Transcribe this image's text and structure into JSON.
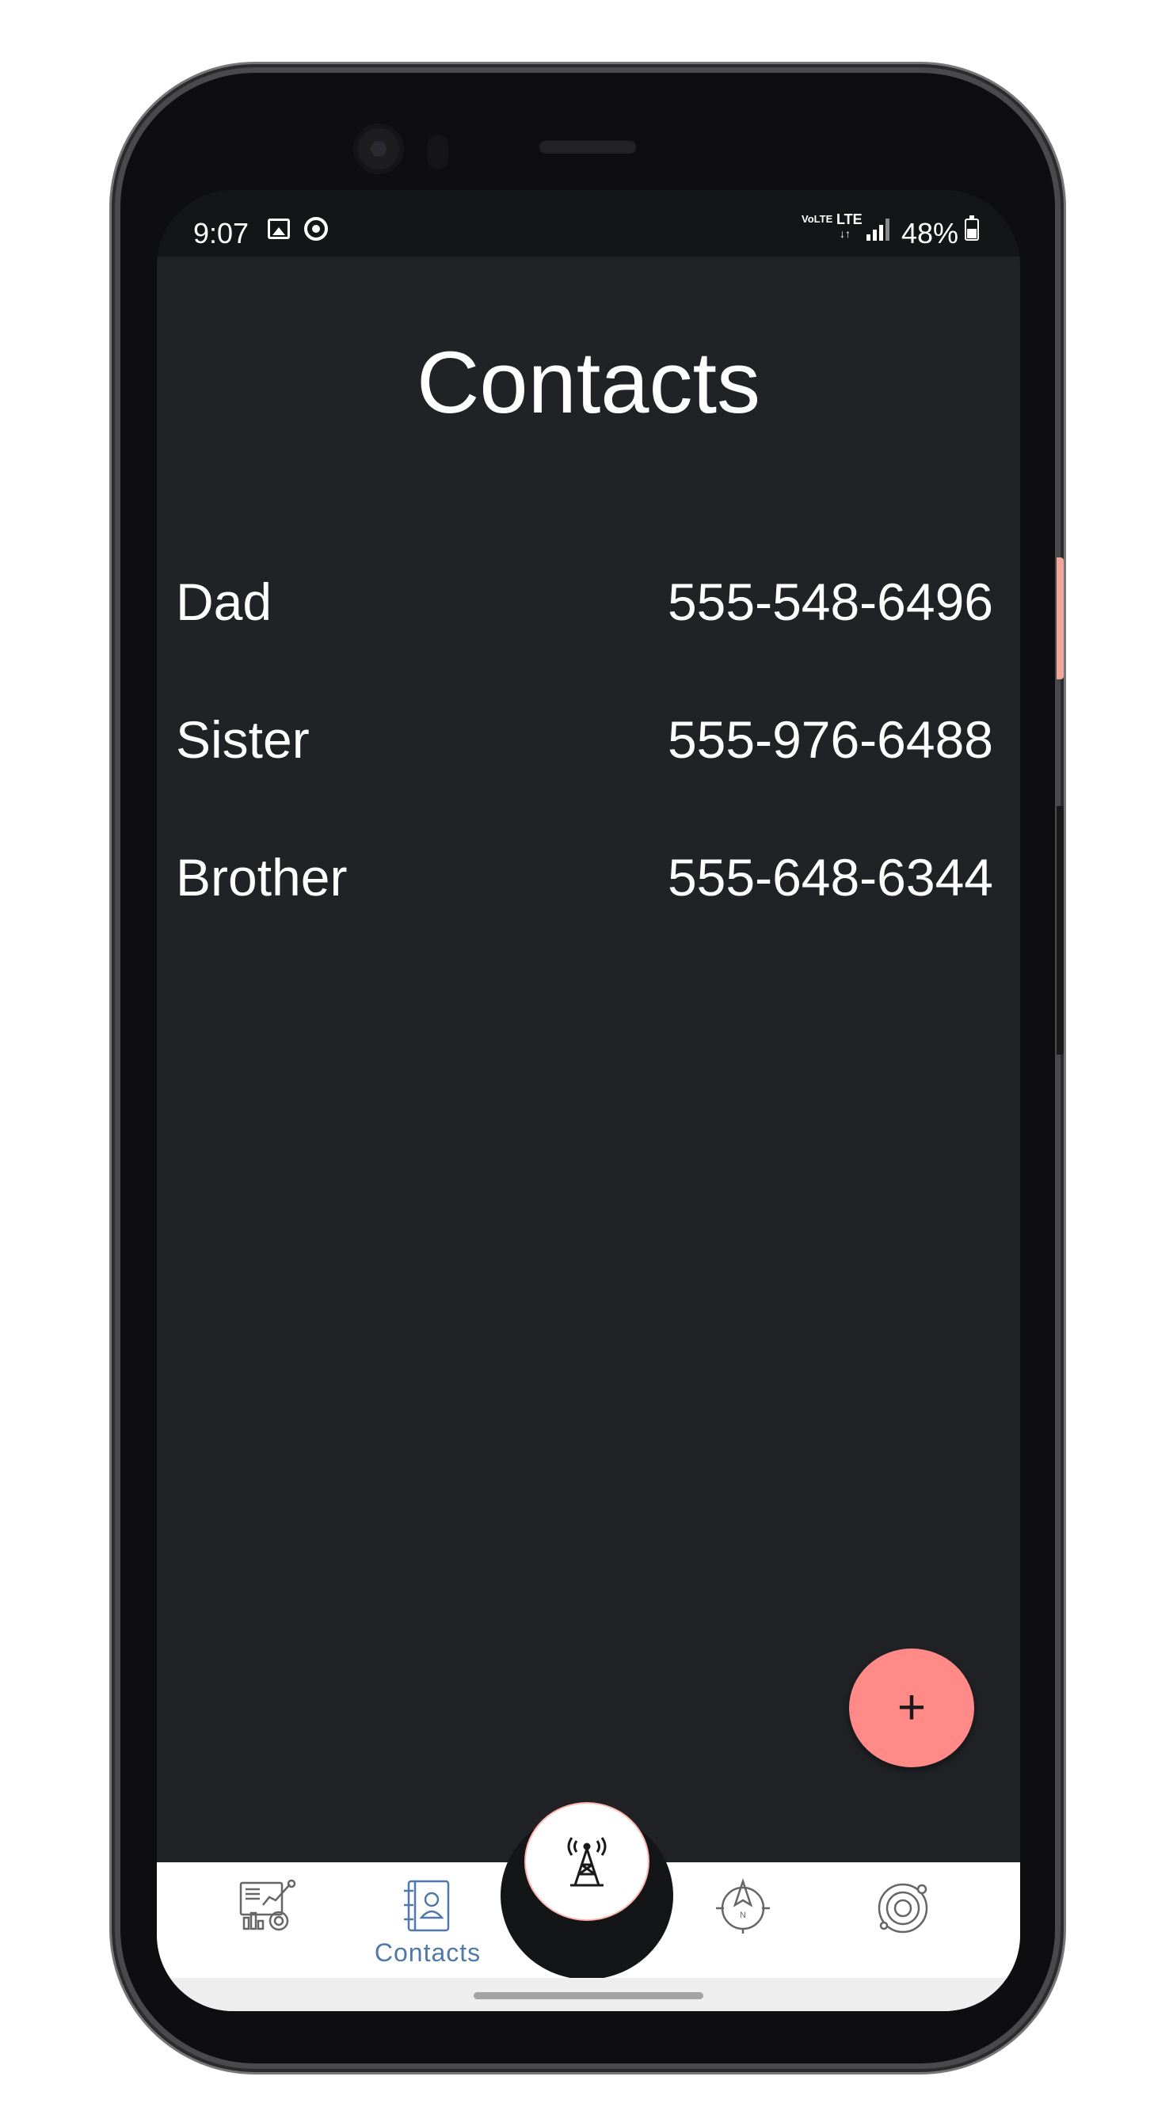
{
  "status_bar": {
    "time": "9:07",
    "network_volte": "VoLTE",
    "network_type": "LTE",
    "battery": "48%"
  },
  "page": {
    "title": "Contacts"
  },
  "contacts": [
    {
      "name": "Dad",
      "phone": "555-548-6496"
    },
    {
      "name": "Sister",
      "phone": "555-976-6488"
    },
    {
      "name": "Brother",
      "phone": "555-648-6344"
    }
  ],
  "fab": {
    "label": "+"
  },
  "bottom_nav": {
    "items": [
      {
        "icon": "analytics-icon",
        "label": ""
      },
      {
        "icon": "contacts-book-icon",
        "label": "Contacts",
        "active": true
      },
      {
        "icon": "cell-tower-icon",
        "label": ""
      },
      {
        "icon": "compass-icon",
        "label": ""
      },
      {
        "icon": "orbit-icon",
        "label": ""
      }
    ]
  },
  "colors": {
    "background": "#202225",
    "status_bar": "#141517",
    "fab": "#ff8a87",
    "nav_active": "#4f79a8",
    "text": "#ffffff"
  }
}
